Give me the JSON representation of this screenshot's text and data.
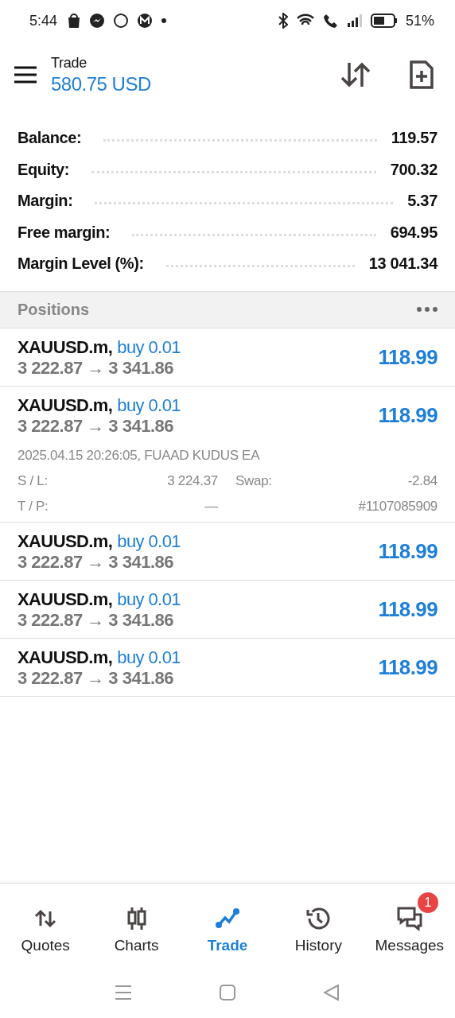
{
  "status_bar": {
    "time": "5:44",
    "battery": "51%"
  },
  "header": {
    "title": "Trade",
    "balance": "580.75 USD"
  },
  "summary": [
    {
      "label": "Balance:",
      "value": "119.57"
    },
    {
      "label": "Equity:",
      "value": "700.32"
    },
    {
      "label": "Margin:",
      "value": "5.37"
    },
    {
      "label": "Free margin:",
      "value": "694.95"
    },
    {
      "label": "Margin Level (%):",
      "value": "13 041.34"
    }
  ],
  "positions_header": {
    "title": "Positions"
  },
  "positions": [
    {
      "symbol": "XAUUSD.m,",
      "order": "buy 0.01",
      "prices": "3 222.87 → 3 341.86",
      "profit": "118.99"
    },
    {
      "symbol": "XAUUSD.m,",
      "order": "buy 0.01",
      "prices": "3 222.87 → 3 341.86",
      "profit": "118.99",
      "details": {
        "opened": "2025.04.15 20:26:05, FUAAD KUDUS EA",
        "sl_label": "S / L:",
        "sl": "3 224.37",
        "swap_label": "Swap:",
        "swap": "-2.84",
        "tp_label": "T / P:",
        "tp": "—",
        "ticket": "#1107085909"
      }
    },
    {
      "symbol": "XAUUSD.m,",
      "order": "buy 0.01",
      "prices": "3 222.87 → 3 341.86",
      "profit": "118.99"
    },
    {
      "symbol": "XAUUSD.m,",
      "order": "buy 0.01",
      "prices": "3 222.87 → 3 341.86",
      "profit": "118.99"
    },
    {
      "symbol": "XAUUSD.m,",
      "order": "buy 0.01",
      "prices": "3 222.87 → 3 341.86",
      "profit": "118.99"
    }
  ],
  "bottom_nav": [
    {
      "label": "Quotes",
      "selected": false
    },
    {
      "label": "Charts",
      "selected": false
    },
    {
      "label": "Trade",
      "selected": true
    },
    {
      "label": "History",
      "selected": false
    },
    {
      "label": "Messages",
      "selected": false,
      "badge": "1"
    }
  ]
}
